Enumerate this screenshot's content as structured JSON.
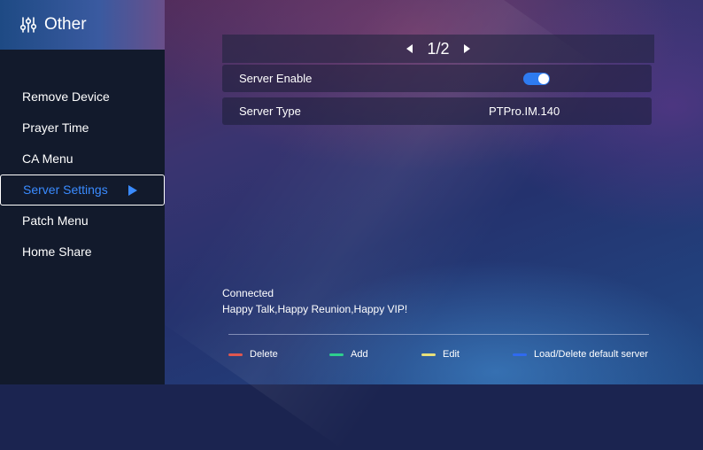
{
  "sidebar": {
    "title": "Other",
    "title_icon": "sliders-icon",
    "items": [
      {
        "label": "Remove Device"
      },
      {
        "label": "Prayer Time"
      },
      {
        "label": "CA Menu"
      },
      {
        "label": "Server Settings",
        "selected": true
      },
      {
        "label": "Patch Menu"
      },
      {
        "label": "Home Share"
      }
    ]
  },
  "pager": {
    "page": "1/2"
  },
  "settings": {
    "server_enable": {
      "label": "Server Enable",
      "value": true
    },
    "server_type": {
      "label": "Server Type",
      "value": "PTPro.IM.140"
    }
  },
  "status": {
    "line1": "Connected",
    "line2": "Happy Talk,Happy Reunion,Happy VIP!"
  },
  "legend": [
    {
      "label": "Delete",
      "color": "#e0574f"
    },
    {
      "label": "Add",
      "color": "#2ecf8e"
    },
    {
      "label": "Edit",
      "color": "#e8e07a"
    },
    {
      "label": "Load/Delete default server",
      "color": "#2f6af0"
    }
  ],
  "colors": {
    "accent": "#3a8bff",
    "toggle_on": "#2e7bf0"
  }
}
